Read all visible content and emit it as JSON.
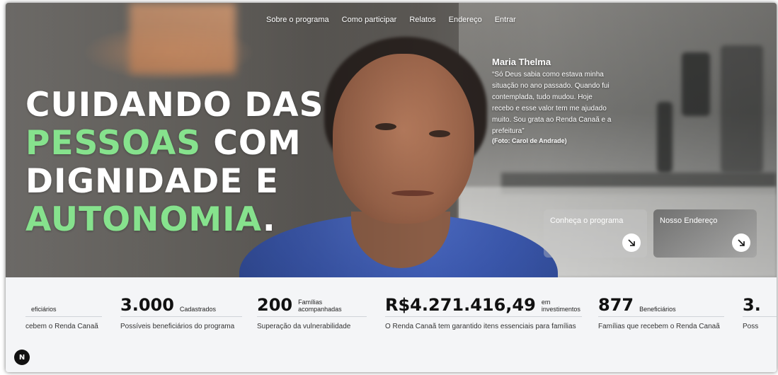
{
  "nav": {
    "items": [
      "Sobre o programa",
      "Como participar",
      "Relatos",
      "Endereço",
      "Entrar"
    ]
  },
  "hero": {
    "line1": "CUIDANDO DAS",
    "line2_green": "PESSOAS",
    "line2_rest": " COM",
    "line3": "DIGNIDADE E",
    "line4_green": "AUTONOMIA",
    "line4_rest": ".",
    "accent_color": "#86e28d"
  },
  "testimonial": {
    "name": "Maria Thelma",
    "quote": "“Só Deus sabia como estava minha situação no ano passado. Quando fui contemplada, tudo mudou. Hoje recebo e esse valor tem me ajudado muito. Sou grata ao Renda Canaã e a prefeitura”",
    "credit": "(Foto: Carol de Andrade)"
  },
  "cta": {
    "program": "Conheça o programa",
    "address": "Nosso Endereço",
    "arrow_icon": "arrow-down-right-icon"
  },
  "stats": [
    {
      "value": "",
      "label": "eficiários",
      "desc": "cebem o Renda Canaã"
    },
    {
      "value": "3.000",
      "label": "Cadastrados",
      "desc": "Possíveis beneficiários do programa"
    },
    {
      "value": "200",
      "label": "Famílias acompanhadas",
      "desc": "Superação da vulnerabilidade"
    },
    {
      "value": "R$4.271.416,49",
      "label": "em investimentos",
      "desc": "O Renda Canaã tem garantido itens essenciais para famílias"
    },
    {
      "value": "877",
      "label": "Beneficiários",
      "desc": "Famílias que recebem o Renda Canaã"
    },
    {
      "value": "3.",
      "label": "",
      "desc": "Poss"
    }
  ],
  "badge": "N"
}
